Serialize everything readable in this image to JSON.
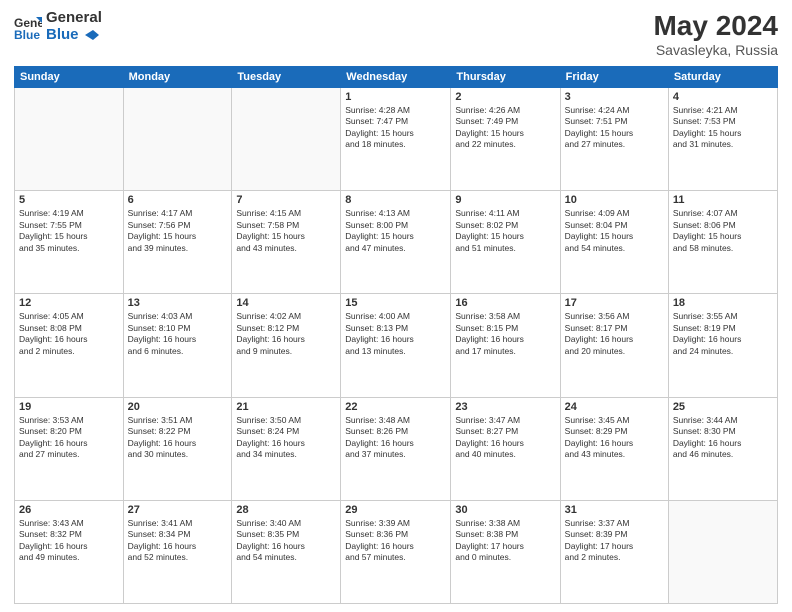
{
  "header": {
    "logo_general": "General",
    "logo_blue": "Blue",
    "month_year": "May 2024",
    "location": "Savasleyka, Russia"
  },
  "weekdays": [
    "Sunday",
    "Monday",
    "Tuesday",
    "Wednesday",
    "Thursday",
    "Friday",
    "Saturday"
  ],
  "weeks": [
    [
      {
        "day": "",
        "info": ""
      },
      {
        "day": "",
        "info": ""
      },
      {
        "day": "",
        "info": ""
      },
      {
        "day": "1",
        "info": "Sunrise: 4:28 AM\nSunset: 7:47 PM\nDaylight: 15 hours\nand 18 minutes."
      },
      {
        "day": "2",
        "info": "Sunrise: 4:26 AM\nSunset: 7:49 PM\nDaylight: 15 hours\nand 22 minutes."
      },
      {
        "day": "3",
        "info": "Sunrise: 4:24 AM\nSunset: 7:51 PM\nDaylight: 15 hours\nand 27 minutes."
      },
      {
        "day": "4",
        "info": "Sunrise: 4:21 AM\nSunset: 7:53 PM\nDaylight: 15 hours\nand 31 minutes."
      }
    ],
    [
      {
        "day": "5",
        "info": "Sunrise: 4:19 AM\nSunset: 7:55 PM\nDaylight: 15 hours\nand 35 minutes."
      },
      {
        "day": "6",
        "info": "Sunrise: 4:17 AM\nSunset: 7:56 PM\nDaylight: 15 hours\nand 39 minutes."
      },
      {
        "day": "7",
        "info": "Sunrise: 4:15 AM\nSunset: 7:58 PM\nDaylight: 15 hours\nand 43 minutes."
      },
      {
        "day": "8",
        "info": "Sunrise: 4:13 AM\nSunset: 8:00 PM\nDaylight: 15 hours\nand 47 minutes."
      },
      {
        "day": "9",
        "info": "Sunrise: 4:11 AM\nSunset: 8:02 PM\nDaylight: 15 hours\nand 51 minutes."
      },
      {
        "day": "10",
        "info": "Sunrise: 4:09 AM\nSunset: 8:04 PM\nDaylight: 15 hours\nand 54 minutes."
      },
      {
        "day": "11",
        "info": "Sunrise: 4:07 AM\nSunset: 8:06 PM\nDaylight: 15 hours\nand 58 minutes."
      }
    ],
    [
      {
        "day": "12",
        "info": "Sunrise: 4:05 AM\nSunset: 8:08 PM\nDaylight: 16 hours\nand 2 minutes."
      },
      {
        "day": "13",
        "info": "Sunrise: 4:03 AM\nSunset: 8:10 PM\nDaylight: 16 hours\nand 6 minutes."
      },
      {
        "day": "14",
        "info": "Sunrise: 4:02 AM\nSunset: 8:12 PM\nDaylight: 16 hours\nand 9 minutes."
      },
      {
        "day": "15",
        "info": "Sunrise: 4:00 AM\nSunset: 8:13 PM\nDaylight: 16 hours\nand 13 minutes."
      },
      {
        "day": "16",
        "info": "Sunrise: 3:58 AM\nSunset: 8:15 PM\nDaylight: 16 hours\nand 17 minutes."
      },
      {
        "day": "17",
        "info": "Sunrise: 3:56 AM\nSunset: 8:17 PM\nDaylight: 16 hours\nand 20 minutes."
      },
      {
        "day": "18",
        "info": "Sunrise: 3:55 AM\nSunset: 8:19 PM\nDaylight: 16 hours\nand 24 minutes."
      }
    ],
    [
      {
        "day": "19",
        "info": "Sunrise: 3:53 AM\nSunset: 8:20 PM\nDaylight: 16 hours\nand 27 minutes."
      },
      {
        "day": "20",
        "info": "Sunrise: 3:51 AM\nSunset: 8:22 PM\nDaylight: 16 hours\nand 30 minutes."
      },
      {
        "day": "21",
        "info": "Sunrise: 3:50 AM\nSunset: 8:24 PM\nDaylight: 16 hours\nand 34 minutes."
      },
      {
        "day": "22",
        "info": "Sunrise: 3:48 AM\nSunset: 8:26 PM\nDaylight: 16 hours\nand 37 minutes."
      },
      {
        "day": "23",
        "info": "Sunrise: 3:47 AM\nSunset: 8:27 PM\nDaylight: 16 hours\nand 40 minutes."
      },
      {
        "day": "24",
        "info": "Sunrise: 3:45 AM\nSunset: 8:29 PM\nDaylight: 16 hours\nand 43 minutes."
      },
      {
        "day": "25",
        "info": "Sunrise: 3:44 AM\nSunset: 8:30 PM\nDaylight: 16 hours\nand 46 minutes."
      }
    ],
    [
      {
        "day": "26",
        "info": "Sunrise: 3:43 AM\nSunset: 8:32 PM\nDaylight: 16 hours\nand 49 minutes."
      },
      {
        "day": "27",
        "info": "Sunrise: 3:41 AM\nSunset: 8:34 PM\nDaylight: 16 hours\nand 52 minutes."
      },
      {
        "day": "28",
        "info": "Sunrise: 3:40 AM\nSunset: 8:35 PM\nDaylight: 16 hours\nand 54 minutes."
      },
      {
        "day": "29",
        "info": "Sunrise: 3:39 AM\nSunset: 8:36 PM\nDaylight: 16 hours\nand 57 minutes."
      },
      {
        "day": "30",
        "info": "Sunrise: 3:38 AM\nSunset: 8:38 PM\nDaylight: 17 hours\nand 0 minutes."
      },
      {
        "day": "31",
        "info": "Sunrise: 3:37 AM\nSunset: 8:39 PM\nDaylight: 17 hours\nand 2 minutes."
      },
      {
        "day": "",
        "info": ""
      }
    ]
  ]
}
